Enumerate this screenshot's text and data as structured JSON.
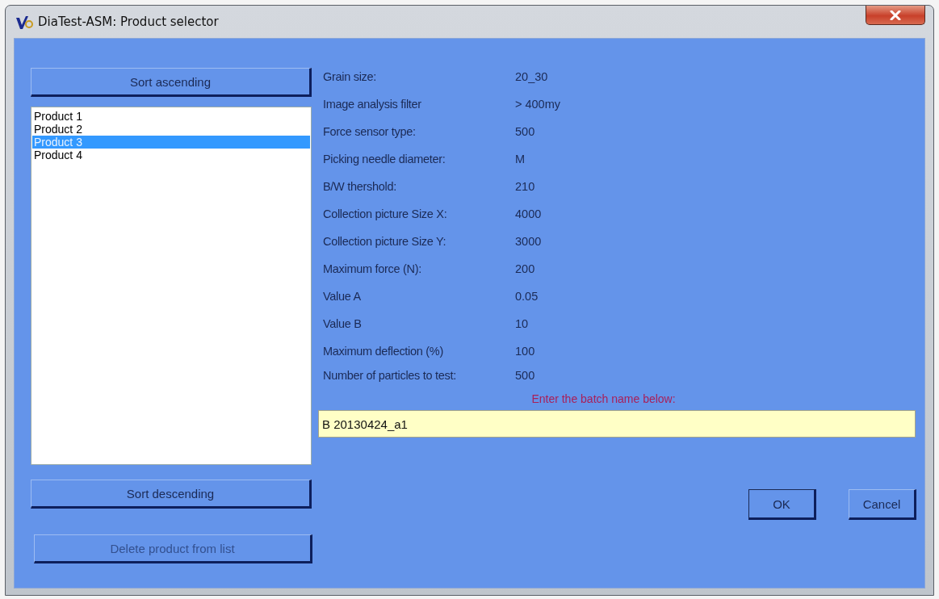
{
  "window": {
    "title": "DiaTest-ASM: Product selector"
  },
  "sort_ascending": {
    "label": "Sort ascending",
    "disabled": false
  },
  "products": [
    {
      "label": "Product 1",
      "selected": false
    },
    {
      "label": "Product 2",
      "selected": false
    },
    {
      "label": "Product 3",
      "selected": true
    },
    {
      "label": "Product 4",
      "selected": false
    }
  ],
  "sort_descending": {
    "label": "Sort descending",
    "disabled": false
  },
  "delete_product": {
    "label": "Delete product from list",
    "disabled": true
  },
  "properties": [
    {
      "label": "Grain size:",
      "value": "20_30"
    },
    {
      "label": "Image analysis filter",
      "value": "> 400my"
    },
    {
      "label": "Force sensor type:",
      "value": "500"
    },
    {
      "label": "Picking needle diameter:",
      "value": "M"
    },
    {
      "label": "B/W thershold:",
      "value": "210"
    },
    {
      "label": "Collection picture Size X:",
      "value": "4000"
    },
    {
      "label": "Collection picture Size Y:",
      "value": "3000"
    },
    {
      "label": "Maximum force (N):",
      "value": "200"
    },
    {
      "label": "Value A",
      "value": "0.05"
    },
    {
      "label": "Value B",
      "value": "10"
    },
    {
      "label": "Maximum deflection (%)",
      "value": "100"
    },
    {
      "label": "Number of particles to test:",
      "value": "500"
    }
  ],
  "batch": {
    "prompt": "Enter the batch name below:",
    "value": "B 20130424_a1"
  },
  "ok_button": {
    "label": "OK",
    "disabled": false
  },
  "cancel_button": {
    "label": "Cancel",
    "disabled": false
  }
}
